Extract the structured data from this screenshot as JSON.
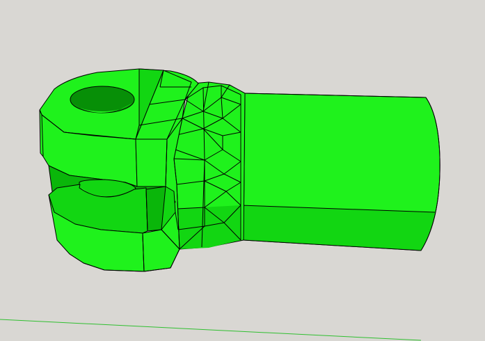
{
  "scene": {
    "background_color": "#d9d7d3",
    "model": {
      "name": "clevis-rod-end",
      "colors": {
        "fill": "#1ff21c",
        "fill_light": "#2ef52a",
        "fill_mid": "#12d612",
        "fill_shadow": "#0ab60a",
        "fill_dark": "#078f07",
        "edge": "#000000"
      }
    },
    "axis": {
      "name": "green-axis",
      "color": "#2fbf2f"
    }
  }
}
